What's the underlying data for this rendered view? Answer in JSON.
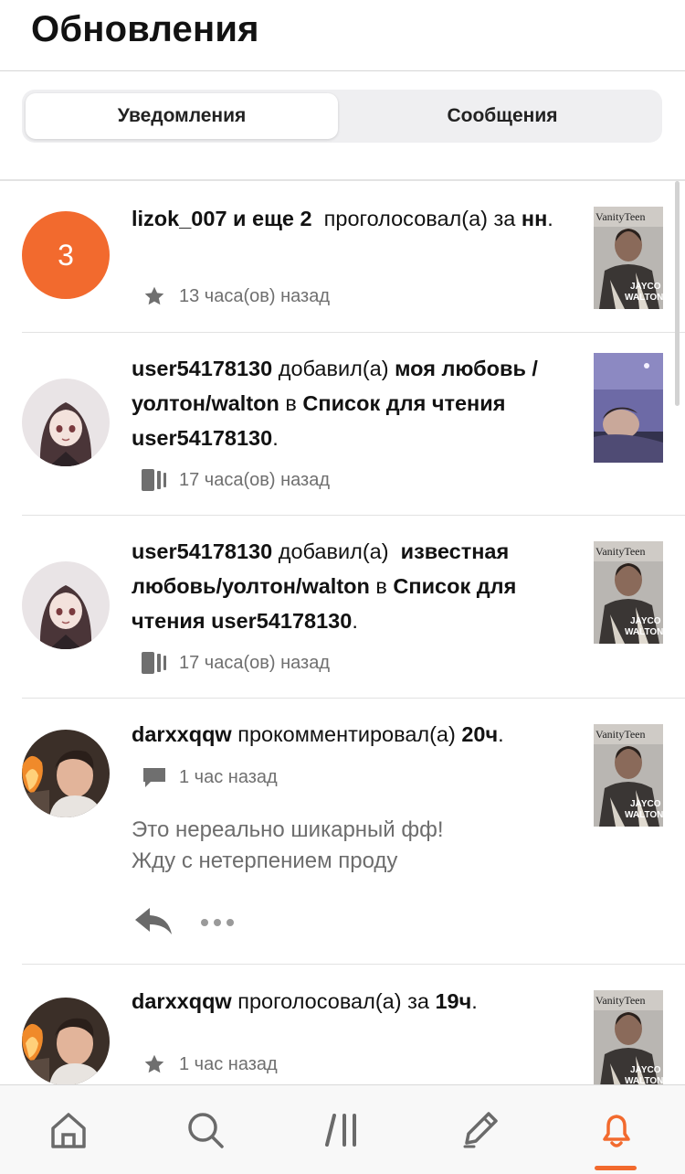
{
  "header": {
    "title": "Обновления"
  },
  "tabs": [
    {
      "label": "Уведомления",
      "selected": true
    },
    {
      "label": "Сообщения",
      "selected": false
    }
  ],
  "colors": {
    "accent": "#f26a2e",
    "text": "#121212",
    "muted": "#6f6f6f"
  },
  "notifications": [
    {
      "avatar_count": "3",
      "actor": "lizok_007 и еще 2",
      "action": "проголосовал(а) за",
      "target": "нн",
      "suffix": ".",
      "meta_icon": "star-icon",
      "time": "13 часа(ов) назад"
    },
    {
      "actor": "user54178130",
      "action": "добавил(а)",
      "target": "моя любовь /уолтон/walton",
      "middle": "в",
      "list": "Список для чтения user54178130",
      "suffix": ".",
      "meta_icon": "reading-list-icon",
      "time": "17 часа(ов) назад"
    },
    {
      "actor": "user54178130",
      "action": "добавил(а)",
      "target": "известная любовь/уолтон/walton",
      "middle": "в",
      "list": "Список для чтения user54178130",
      "suffix": ".",
      "meta_icon": "reading-list-icon",
      "time": "17 часа(ов) назад"
    },
    {
      "actor": "darxxqqw",
      "action": "прокомментировал(а)",
      "target": "20ч",
      "suffix": ".",
      "meta_icon": "comment-icon",
      "time": "1 час назад",
      "comment_line1": "Это нереально шикарный фф!",
      "comment_line2": "Жду с нетерпением проду"
    },
    {
      "actor": "darxxqqw",
      "action": "проголосовал(а) за",
      "target": "19ч",
      "suffix": ".",
      "meta_icon": "star-icon",
      "time": "1 час назад"
    }
  ],
  "cover": {
    "brand": "VanityTeen",
    "title_lines": [
      "JAYCO",
      "WALTON"
    ]
  },
  "bottom_nav": [
    {
      "name": "home-icon",
      "active": false
    },
    {
      "name": "search-icon",
      "active": false
    },
    {
      "name": "library-icon",
      "active": false
    },
    {
      "name": "write-icon",
      "active": false
    },
    {
      "name": "notifications-bell-icon",
      "active": true
    }
  ]
}
